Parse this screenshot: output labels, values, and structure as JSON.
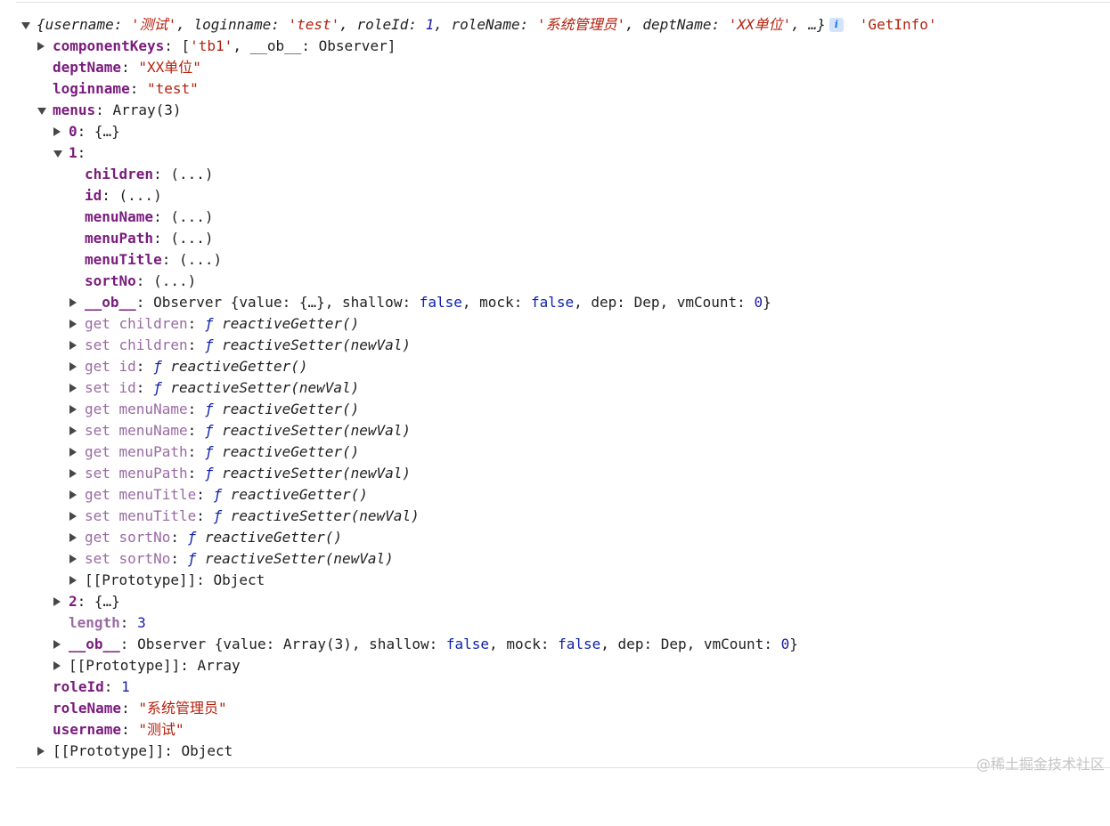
{
  "summary": {
    "open": "{",
    "k_username": "username",
    "v_username": "'测试'",
    "k_loginname": "loginname",
    "v_loginname": "'test'",
    "k_roleId": "roleId",
    "v_roleId": "1",
    "k_roleName": "roleName",
    "v_roleName": "'系统管理员'",
    "k_deptName": "deptName",
    "v_deptName": "'XX单位'",
    "close": ", …}",
    "info_icon": "i",
    "source_label": "'GetInfo'"
  },
  "componentKeys": {
    "key": "componentKeys",
    "open": "[",
    "v1": "'tb1'",
    "k_ob": "__ob__",
    "v_ob": "Observer",
    "close": "]"
  },
  "deptName": {
    "key": "deptName",
    "value": "\"XX单位\""
  },
  "loginname": {
    "key": "loginname",
    "value": "\"test\""
  },
  "menus": {
    "key": "menus",
    "value": "Array(3)",
    "item0": {
      "key": "0",
      "value": "{…}"
    },
    "item1": {
      "key": "1",
      "props": [
        {
          "key": "children",
          "value": "(...)"
        },
        {
          "key": "id",
          "value": "(...)"
        },
        {
          "key": "menuName",
          "value": "(...)"
        },
        {
          "key": "menuPath",
          "value": "(...)"
        },
        {
          "key": "menuTitle",
          "value": "(...)"
        },
        {
          "key": "sortNo",
          "value": "(...)"
        }
      ],
      "ob": {
        "key": "__ob__",
        "type": "Observer",
        "open": "{",
        "k_value": "value",
        "v_value": "{…}",
        "k_shallow": "shallow",
        "v_shallow": "false",
        "k_mock": "mock",
        "v_mock": "false",
        "k_dep": "dep",
        "v_dep": "Dep",
        "k_vmCount": "vmCount",
        "v_vmCount": "0",
        "close": "}"
      },
      "accessors": [
        {
          "label": "get children",
          "f": "ƒ",
          "fn": "reactiveGetter()"
        },
        {
          "label": "set children",
          "f": "ƒ",
          "fn": "reactiveSetter(newVal)"
        },
        {
          "label": "get id",
          "f": "ƒ",
          "fn": "reactiveGetter()"
        },
        {
          "label": "set id",
          "f": "ƒ",
          "fn": "reactiveSetter(newVal)"
        },
        {
          "label": "get menuName",
          "f": "ƒ",
          "fn": "reactiveGetter()"
        },
        {
          "label": "set menuName",
          "f": "ƒ",
          "fn": "reactiveSetter(newVal)"
        },
        {
          "label": "get menuPath",
          "f": "ƒ",
          "fn": "reactiveGetter()"
        },
        {
          "label": "set menuPath",
          "f": "ƒ",
          "fn": "reactiveSetter(newVal)"
        },
        {
          "label": "get menuTitle",
          "f": "ƒ",
          "fn": "reactiveGetter()"
        },
        {
          "label": "set menuTitle",
          "f": "ƒ",
          "fn": "reactiveSetter(newVal)"
        },
        {
          "label": "get sortNo",
          "f": "ƒ",
          "fn": "reactiveGetter()"
        },
        {
          "label": "set sortNo",
          "f": "ƒ",
          "fn": "reactiveSetter(newVal)"
        }
      ],
      "proto": {
        "key": "[[Prototype]]",
        "value": "Object"
      }
    },
    "item2": {
      "key": "2",
      "value": "{…}"
    },
    "length": {
      "key": "length",
      "value": "3"
    },
    "ob": {
      "key": "__ob__",
      "type": "Observer",
      "open": "{",
      "k_value": "value",
      "v_value": "Array(3)",
      "k_shallow": "shallow",
      "v_shallow": "false",
      "k_mock": "mock",
      "v_mock": "false",
      "k_dep": "dep",
      "v_dep": "Dep",
      "k_vmCount": "vmCount",
      "v_vmCount": "0",
      "close": "}"
    },
    "proto": {
      "key": "[[Prototype]]",
      "value": "Array"
    }
  },
  "roleId": {
    "key": "roleId",
    "value": "1"
  },
  "roleName": {
    "key": "roleName",
    "value": "\"系统管理员\""
  },
  "username": {
    "key": "username",
    "value": "\"测试\""
  },
  "proto": {
    "key": "[[Prototype]]",
    "value": "Object"
  },
  "watermark": "@稀土掘金技术社区"
}
